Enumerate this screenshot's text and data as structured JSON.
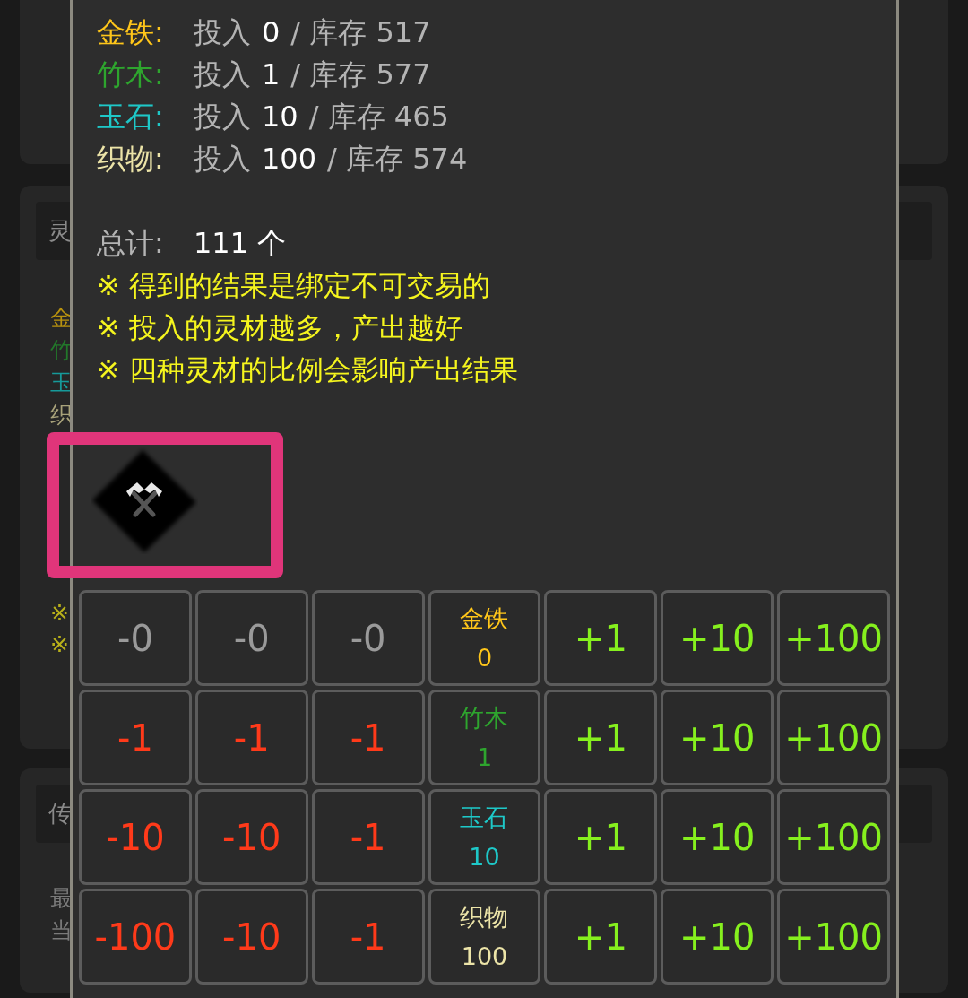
{
  "background": {
    "cards": [
      {
        "header": "灵",
        "lines": [
          {
            "text": "金",
            "color": "#b8920f"
          },
          {
            "text": "竹",
            "color": "#22782a"
          },
          {
            "text": "玉",
            "color": "#169a9a"
          },
          {
            "text": "织",
            "color": "#a8a27a"
          }
        ],
        "notes": [
          "※",
          "※"
        ]
      },
      {
        "header": "传",
        "lines": [
          {
            "text": "最",
            "color": "#7a7a7a"
          },
          {
            "text": "当",
            "color": "#7a7a7a"
          }
        ]
      }
    ]
  },
  "dialog": {
    "materials": [
      {
        "name": "金铁:",
        "color": "#ffc61a",
        "invest_label": "投入",
        "invested": "0",
        "stock_label": "/ 库存 517"
      },
      {
        "name": "竹木:",
        "color": "#2ea52e",
        "invest_label": "投入",
        "invested": "1",
        "stock_label": "/ 库存 577"
      },
      {
        "name": "玉石:",
        "color": "#1ec8c8",
        "invest_label": "投入",
        "invested": "10",
        "stock_label": "/ 库存 465"
      },
      {
        "name": "织物:",
        "color": "#ece4a8",
        "invest_label": "投入",
        "invested": "100",
        "stock_label": "/ 库存 574"
      }
    ],
    "total": {
      "label": "总计:",
      "value": "111 个"
    },
    "notes": [
      "※ 得到的结果是绑定不可交易的",
      "※ 投入的灵材越多，产出越好",
      "※ 四种灵材的比例会影响产出结果"
    ],
    "grid": [
      {
        "decrease": [
          {
            "label": "-0",
            "disabled": true
          },
          {
            "label": "-0",
            "disabled": true
          },
          {
            "label": "-0",
            "disabled": true
          }
        ],
        "name": "金铁",
        "value": "0",
        "color": "#ffc61a",
        "increase": [
          {
            "label": "+1",
            "disabled": false
          },
          {
            "label": "+10",
            "disabled": false
          },
          {
            "label": "+100",
            "disabled": false
          }
        ]
      },
      {
        "decrease": [
          {
            "label": "-1",
            "disabled": false
          },
          {
            "label": "-1",
            "disabled": false
          },
          {
            "label": "-1",
            "disabled": false
          }
        ],
        "name": "竹木",
        "value": "1",
        "color": "#2ea52e",
        "increase": [
          {
            "label": "+1",
            "disabled": false
          },
          {
            "label": "+10",
            "disabled": false
          },
          {
            "label": "+100",
            "disabled": false
          }
        ]
      },
      {
        "decrease": [
          {
            "label": "-10",
            "disabled": false
          },
          {
            "label": "-10",
            "disabled": false
          },
          {
            "label": "-1",
            "disabled": false
          }
        ],
        "name": "玉石",
        "value": "10",
        "color": "#1ec8c8",
        "increase": [
          {
            "label": "+1",
            "disabled": false
          },
          {
            "label": "+10",
            "disabled": false
          },
          {
            "label": "+100",
            "disabled": false
          }
        ]
      },
      {
        "decrease": [
          {
            "label": "-100",
            "disabled": false
          },
          {
            "label": "-10",
            "disabled": false
          },
          {
            "label": "-1",
            "disabled": false
          }
        ],
        "name": "织物",
        "value": "100",
        "color": "#ece4a8",
        "increase": [
          {
            "label": "+1",
            "disabled": false
          },
          {
            "label": "+10",
            "disabled": false
          },
          {
            "label": "+100",
            "disabled": false
          }
        ]
      }
    ]
  }
}
